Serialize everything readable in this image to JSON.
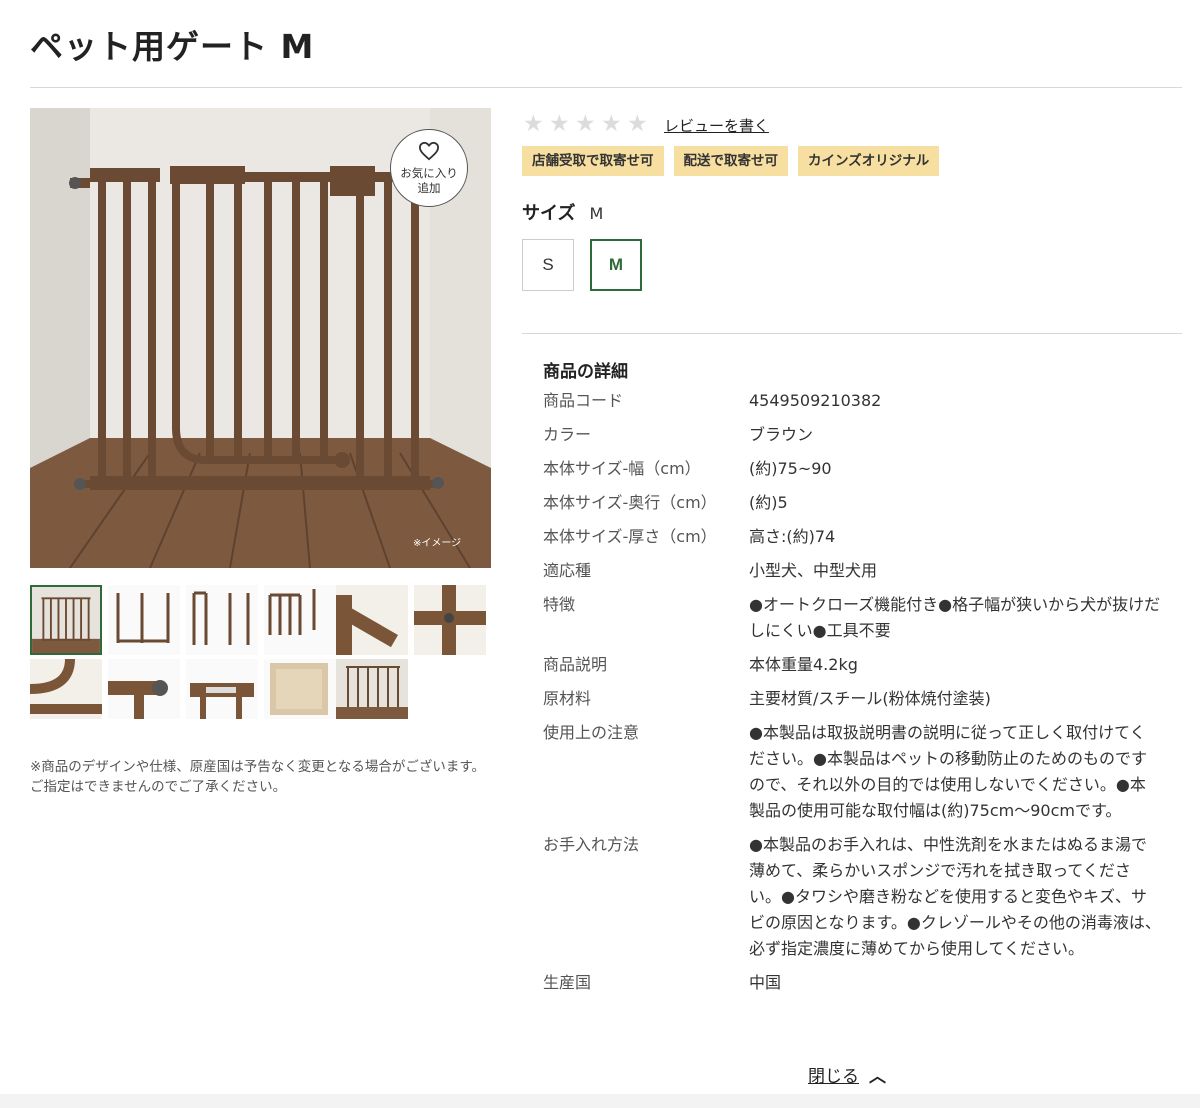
{
  "page": {
    "title": "ペット用ゲート M"
  },
  "gallery": {
    "favorite_label_1": "お気に入り",
    "favorite_label_2": "追加",
    "image_note": "※イメージ",
    "caption": "※商品のデザインや仕様、原産国は予告なく変更となる場合がございます。ご指定はできませんのでご了承ください。",
    "selected_thumbnail": 1,
    "thumbnail_count": 11
  },
  "rating": {
    "stars": 0,
    "max_stars": 5,
    "review_link": "レビューを書く"
  },
  "badges": [
    "店舗受取で取寄せ可",
    "配送で取寄せ可",
    "カインズオリジナル"
  ],
  "size": {
    "label": "サイズ",
    "selected": "M",
    "options": [
      "S",
      "M"
    ]
  },
  "details": {
    "heading": "商品の詳細",
    "rows": [
      {
        "key": "商品コード",
        "value": "4549509210382"
      },
      {
        "key": "カラー",
        "value": "ブラウン"
      },
      {
        "key": "本体サイズ-幅（cm）",
        "value": "(約)75~90"
      },
      {
        "key": "本体サイズ-奥行（cm）",
        "value": "(約)5"
      },
      {
        "key": "本体サイズ-厚さ（cm）",
        "value": "高さ:(約)74"
      },
      {
        "key": "適応種",
        "value": "小型犬、中型犬用"
      },
      {
        "key": "特徴",
        "value": "●オートクローズ機能付き●格子幅が狭いから犬が抜けだしにくい●工具不要"
      },
      {
        "key": "商品説明",
        "value": "本体重量4.2kg"
      },
      {
        "key": "原材料",
        "value": "主要材質/スチール(粉体焼付塗装)"
      },
      {
        "key": "使用上の注意",
        "value": "●本製品は取扱説明書の説明に従って正しく取付けてください。●本製品はペットの移動防止のためのものですので、それ以外の目的では使用しないでください。●本製品の使用可能な取付幅は(約)75cm〜90cmです。"
      },
      {
        "key": "お手入れ方法",
        "value": "●本製品のお手入れは、中性洗剤を水またはぬるま湯で薄めて、柔らかいスポンジで汚れを拭き取ってください。●タワシや磨き粉などを使用すると変色やキズ、サビの原因となります。●クレゾールやその他の消毒液は、必ず指定濃度に薄めてから使用してください。"
      },
      {
        "key": "生産国",
        "value": "中国"
      }
    ],
    "close_label": "閉じる"
  },
  "colors": {
    "accent_green": "#2f6b3a",
    "badge_bg": "#f7dfa1",
    "gate_brown": "#6b4a33"
  }
}
